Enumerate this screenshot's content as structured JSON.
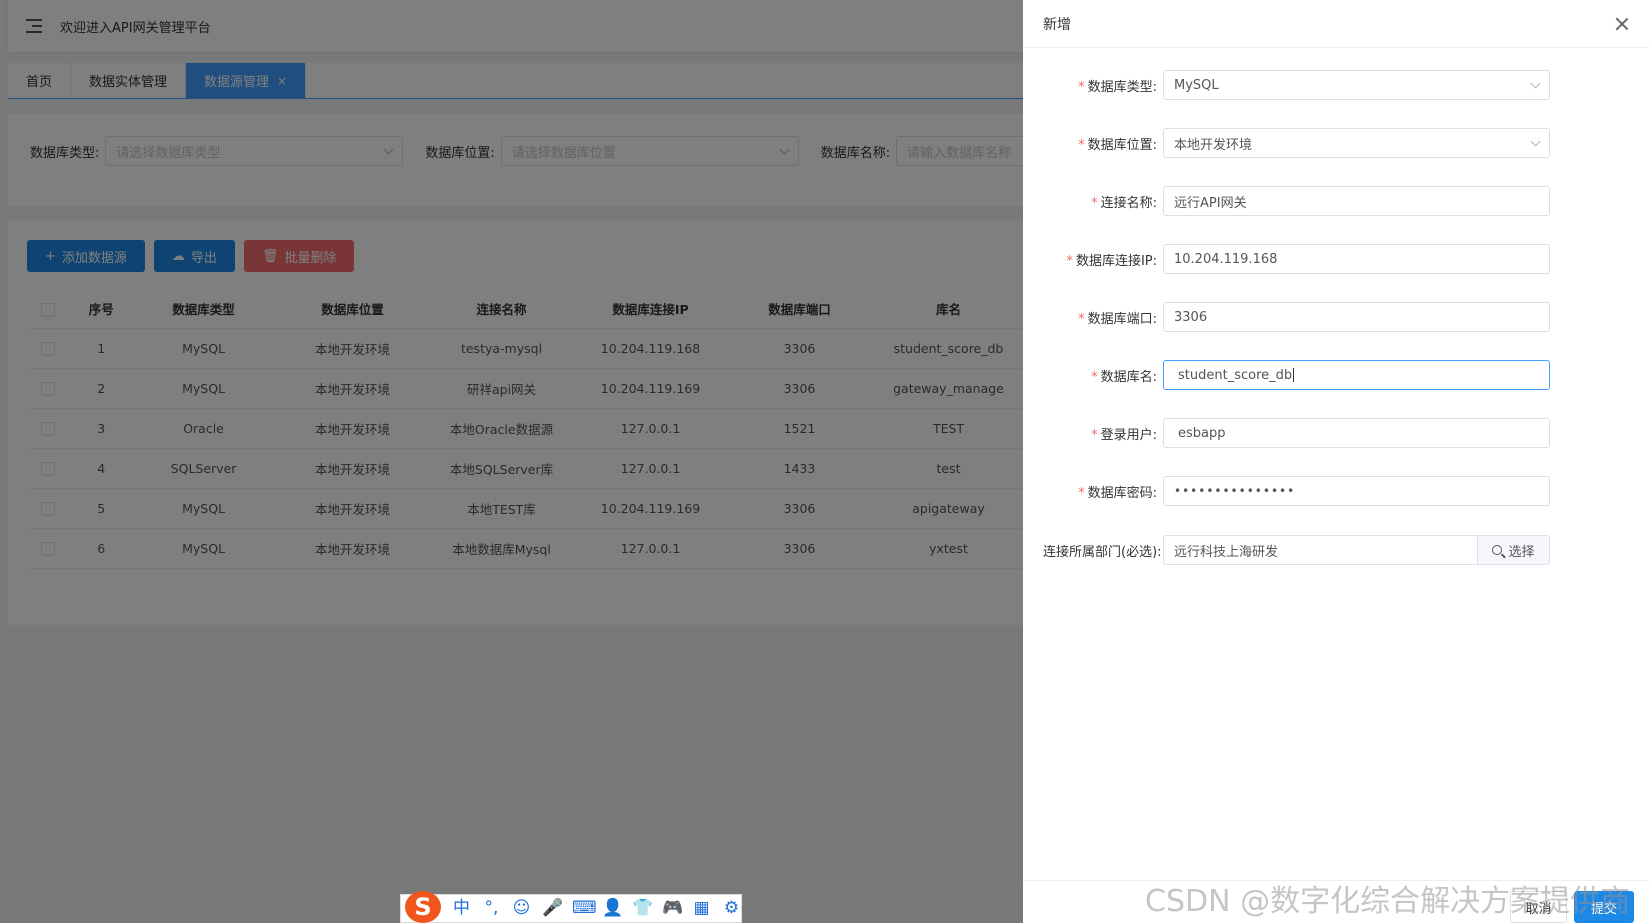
{
  "header": {
    "title": "欢迎进入API网关管理平台"
  },
  "tabs": [
    {
      "label": "首页"
    },
    {
      "label": "数据实体管理"
    },
    {
      "label": "数据源管理",
      "close": "×"
    }
  ],
  "filters": {
    "db_type_label": "数据库类型:",
    "db_type_placeholder": "请选择数据库类型",
    "db_location_label": "数据库位置:",
    "db_location_placeholder": "请选择数据库位置",
    "db_name_label": "数据库名称:",
    "db_name_placeholder": "请输入数据库名称"
  },
  "actions": {
    "add_label": "添加数据源",
    "export_label": "导出",
    "batch_delete_label": "批量删除"
  },
  "table": {
    "columns": [
      "序号",
      "数据库类型",
      "数据库位置",
      "连接名称",
      "数据库连接IP",
      "数据库端口",
      "库名"
    ],
    "rows": [
      [
        "1",
        "MySQL",
        "本地开发环境",
        "testya-mysql",
        "10.204.119.168",
        "3306",
        "student_score_db"
      ],
      [
        "2",
        "MySQL",
        "本地开发环境",
        "研祥api网关",
        "10.204.119.169",
        "3306",
        "gateway_manage"
      ],
      [
        "3",
        "Oracle",
        "本地开发环境",
        "本地Oracle数据源",
        "127.0.0.1",
        "1521",
        "TEST"
      ],
      [
        "4",
        "SQLServer",
        "本地开发环境",
        "本地SQLServer库",
        "127.0.0.1",
        "1433",
        "test"
      ],
      [
        "5",
        "MySQL",
        "本地开发环境",
        "本地TEST库",
        "10.204.119.169",
        "3306",
        "apigateway"
      ],
      [
        "6",
        "MySQL",
        "本地开发环境",
        "本地数据库Mysql",
        "127.0.0.1",
        "3306",
        "yxtest"
      ]
    ]
  },
  "drawer": {
    "title": "新增",
    "fields": {
      "db_type": {
        "label": "数据库类型:",
        "value": "MySQL"
      },
      "db_location": {
        "label": "数据库位置:",
        "value": "本地开发环境"
      },
      "conn_name": {
        "label": "连接名称:",
        "value": "远行API网关"
      },
      "db_ip": {
        "label": "数据库连接IP:",
        "value": "10.204.119.168"
      },
      "db_port": {
        "label": "数据库端口:",
        "value": "3306"
      },
      "db_name": {
        "label": "数据库名:",
        "value": "student_score_db"
      },
      "login_user": {
        "label": "登录用户:",
        "value": "esbapp"
      },
      "db_password": {
        "label": "数据库密码:",
        "value": "•••••••••••••••"
      },
      "dept": {
        "label": "连接所属部门(必选):",
        "value": "远行科技上海研发",
        "button": "选择"
      }
    },
    "cancel_label": "取消",
    "submit_label": "提交"
  },
  "ime": {
    "logo": "S",
    "items": [
      "中",
      "°,",
      "☺",
      "🎤",
      "⌨",
      "👤",
      "👕",
      "🎮",
      "▦",
      "⚙"
    ]
  },
  "watermark": "CSDN @数字化综合解决方案提供商",
  "colors": {
    "primary": "#1e88e5",
    "danger": "#f56c6c",
    "required": "#f56c6c",
    "focus": "#409eff"
  }
}
